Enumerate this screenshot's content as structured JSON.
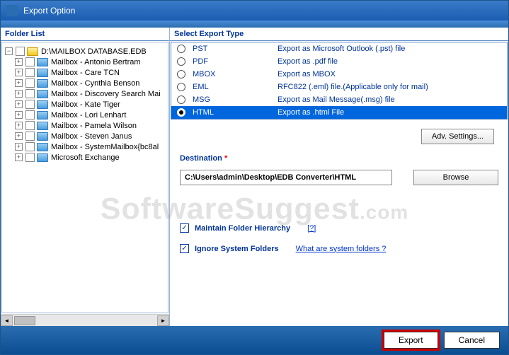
{
  "window": {
    "title": "Export Option"
  },
  "left": {
    "title": "Folder List",
    "root": "D:\\MAILBOX DATABASE.EDB",
    "items": [
      "Mailbox - Antonio Bertram",
      "Mailbox - Care TCN",
      "Mailbox - Cynthia Benson",
      "Mailbox - Discovery Search Mai",
      "Mailbox - Kate Tiger",
      "Mailbox - Lori Lenhart",
      "Mailbox - Pamela Wilson",
      "Mailbox - Steven Janus",
      "Mailbox - SystemMailbox{bc8al",
      "Microsoft Exchange"
    ]
  },
  "right": {
    "title": "Select Export Type",
    "types": [
      {
        "name": "PST",
        "desc": "Export as Microsoft Outlook (.pst) file"
      },
      {
        "name": "PDF",
        "desc": "Export as .pdf file"
      },
      {
        "name": "MBOX",
        "desc": "Export as MBOX"
      },
      {
        "name": "EML",
        "desc": "RFC822 (.eml) file.(Applicable only for mail)"
      },
      {
        "name": "MSG",
        "desc": "Export as Mail Message(.msg) file"
      },
      {
        "name": "HTML",
        "desc": "Export as .html File"
      }
    ],
    "selected_index": 5,
    "adv": "Adv. Settings...",
    "dest_label": "Destination",
    "dest_value": "C:\\Users\\admin\\Desktop\\EDB Converter\\HTML",
    "browse": "Browse",
    "check1": "Maintain Folder Hierarchy",
    "check1_help": "[?]",
    "check2": "Ignore System Folders",
    "check2_link": "What are system folders ?"
  },
  "footer": {
    "export": "Export",
    "cancel": "Cancel"
  },
  "watermark": {
    "main": "SoftwareSuggest",
    "suffix": ".com"
  }
}
